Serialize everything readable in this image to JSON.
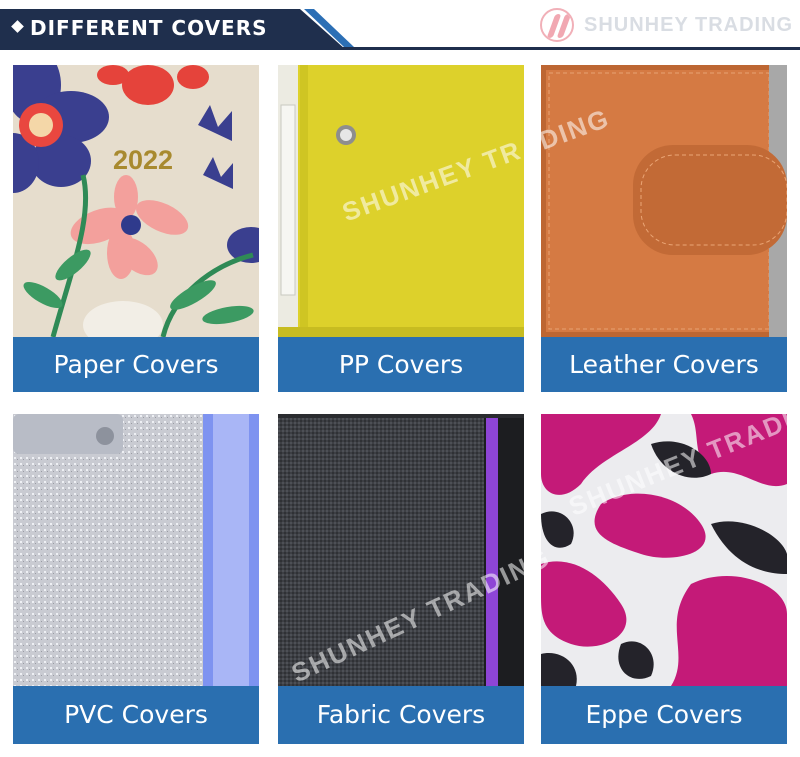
{
  "header": {
    "title": "DIFFERENT COVERS"
  },
  "logo": {
    "text": "SHUNHEY TRADING"
  },
  "watermark": "SHUNHEY TRADING",
  "paper_cover": {
    "year": "2022"
  },
  "cards": [
    {
      "label": "Paper Covers"
    },
    {
      "label": "PP Covers"
    },
    {
      "label": "Leather Covers"
    },
    {
      "label": "PVC Covers"
    },
    {
      "label": "Fabric Covers"
    },
    {
      "label": "Eppe Covers"
    }
  ],
  "colors": {
    "header_bg": "#1f2f4d",
    "accent": "#2a6fb0",
    "label_bg": "#2a6fb0"
  }
}
